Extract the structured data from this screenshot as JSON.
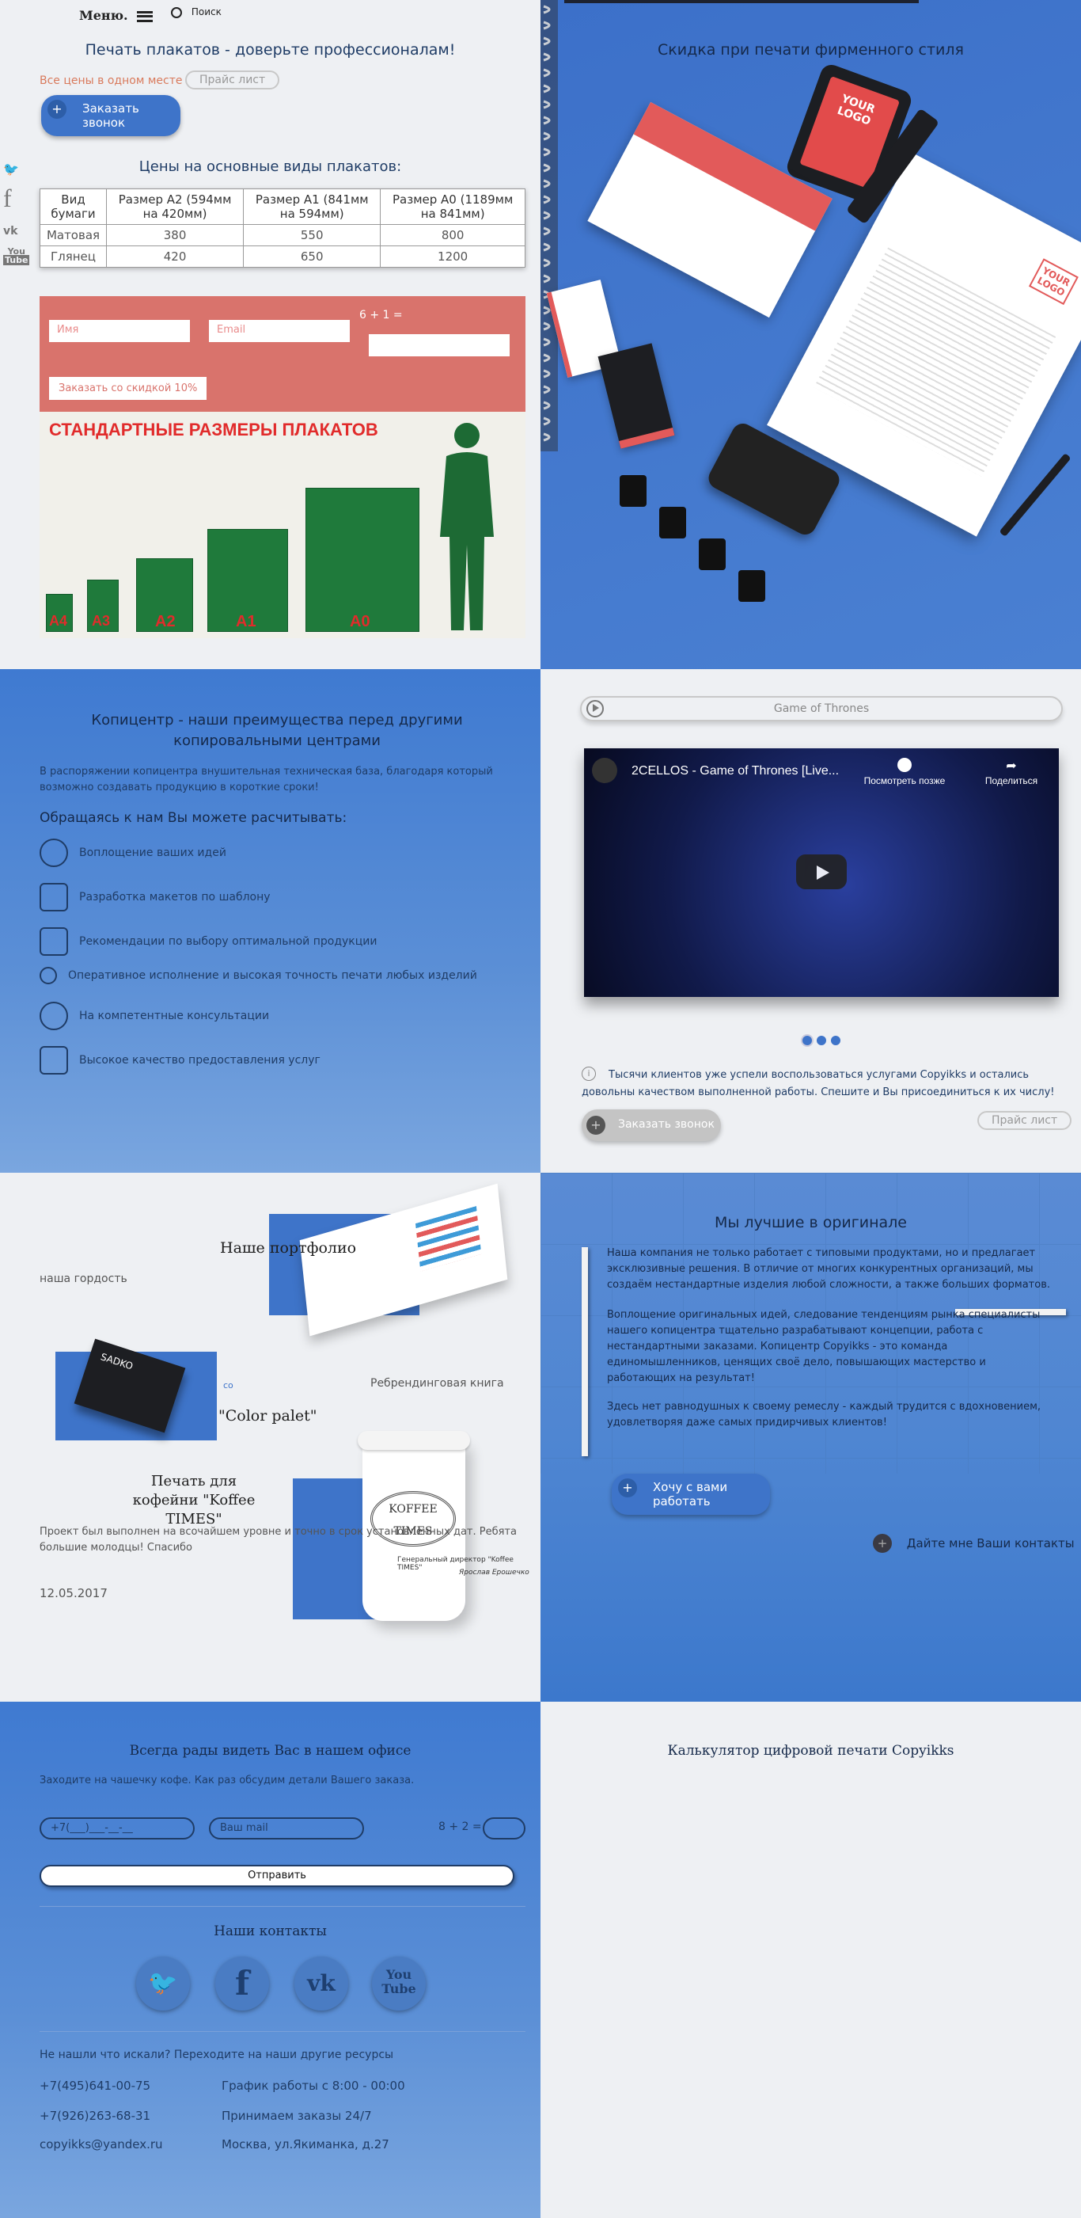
{
  "nav": {
    "menu_label": "Меню.",
    "search_label": "Поиск"
  },
  "social_side": [
    "twitter-icon",
    "facebook-icon",
    "vk-icon",
    "youtube-icon"
  ],
  "hero": {
    "title": "Печать плакатов - доверьте профессионалам!",
    "all_prices_link": "Все цены в одном месте",
    "price_list_btn": "Прайс лист",
    "callback_btn": "Заказать звонок"
  },
  "prices": {
    "heading": "Цены на основные виды плакатов:",
    "columns": [
      "Вид бумаги",
      "Размер А2 (594мм на 420мм)",
      "Размер А1 (841мм на 594мм)",
      "Размер А0 (1189мм на 841мм)"
    ],
    "rows": [
      [
        "Матовая",
        "380",
        "550",
        "800"
      ],
      [
        "Глянец",
        "420",
        "650",
        "1200"
      ]
    ]
  },
  "discount_form": {
    "name_placeholder": "Имя",
    "email_placeholder": "Email",
    "captcha": "6 + 1 =",
    "submit": "Заказать со скидкой 10%"
  },
  "poster_sizes": {
    "title": "СТАНДАРТНЫЕ РАЗМЕРЫ ПЛАКАТОВ",
    "labels": [
      "A4",
      "A3",
      "A2",
      "A1",
      "A0"
    ]
  },
  "branding": {
    "title": "Скидка при печати фирменного стиля",
    "logo_text": "YOUR LOGO"
  },
  "advantages": {
    "title": "Копицентр - наши преимущества перед другими копировальными центрами",
    "intro": "В распоряжении копицентра внушительная техническая база, благодаря который возможно создавать продукцию в короткие сроки!",
    "subtitle": "Обращаясь к нам Вы можете расчитывать:",
    "items": [
      "Воплощение ваших идей",
      "Разработка макетов по шаблону",
      "Рекомендации по выбору оптимальной продукции",
      "Оперативное исполнение и высокая точность печати любых изделий",
      "На компетентные консультации",
      "Высокое качество предоставления услуг"
    ]
  },
  "video": {
    "playlist_title": "Game of Thrones",
    "video_title": "2CELLOS - Game of Thrones [Live...",
    "watch_later": "Посмотреть позже",
    "share": "Поделиться",
    "testimonial": "Тысячи клиентов уже успели воспользоваться услугами Copyikks и остались довольны качеством выполненной работы. Спешите и Вы присоединиться к их числу!",
    "callback_btn": "Заказать звонок",
    "price_btn": "Прайс лист"
  },
  "portfolio": {
    "title": "Наше портфолио",
    "subtitle": "наша гордость",
    "rebranding": "Ребрендинговая книга",
    "color_palet": "\"Color palet\"",
    "coffee_title": "Печать для кофейни \"Koffee TIMES\"",
    "coffee_text": "Проект был выполнен на всочайшем уровне и точно в срок установленных дат. Ребята большие молодцы! Спасибо",
    "date": "12.05.2017",
    "cup_brand": "KOFFEE TIMES",
    "director": "Генеральный директор \"Koffee TIMES\"",
    "director_name": "Ярослав Ерошечко",
    "card_brand": "SADKO",
    "co_mark": "co"
  },
  "best": {
    "title": "Мы лучшие в оригинале",
    "p1": "Наша компания не только работает с типовыми продуктами, но и предлагает эксклюзивные решения. В отличие от многих конкурентных организаций, мы создаём нестандартные изделия любой сложности, а также больших форматов.",
    "p2": "Воплощение оригинальных идей, следование тенденциям рынка специалисты нашего копицентра тщательно разрабатывают концепции, работа с нестандартными заказами. Копицентр Copyikks - это команда единомышленников, ценящих своё дело, повышающих мастерство и работающих на результат!",
    "p3": "Здесь нет равнодушных к своему ремеслу - каждый трудится с вдохновением, удовлетворяя даже самых придирчивых клиентов!",
    "cta": "Хочу с вами работать",
    "contacts_cta": "Дайте мне Ваши контакты"
  },
  "office": {
    "title": "Всегда рады видеть Вас в нашем офисе",
    "intro": "Заходите на чашечку кофе. Как раз обсудим детали Вашего заказа.",
    "phone_placeholder": "+7(___)___-__-__",
    "mail_placeholder": "Ваш mail",
    "captcha": "8 + 2 =",
    "submit": "Отправить"
  },
  "contacts": {
    "title": "Наши контакты",
    "not_found": "Не нашли что искали? Переходите на наши другие ресурсы",
    "phone1": "+7(495)641-00-75",
    "phone2": "+7(926)263-68-31",
    "email": "copyikks@yandex.ru",
    "hours": "График работы с 8:00 - 00:00",
    "orders": "Принимаем заказы 24/7",
    "address": "Москва, ул.Якиманка, д.27"
  },
  "calculator": {
    "title": "Калькулятор цифровой печати Copyikks"
  },
  "colors": {
    "blue": "#3f7ad1",
    "salmon": "#d9736c",
    "poster_green": "#1f7a3b"
  }
}
